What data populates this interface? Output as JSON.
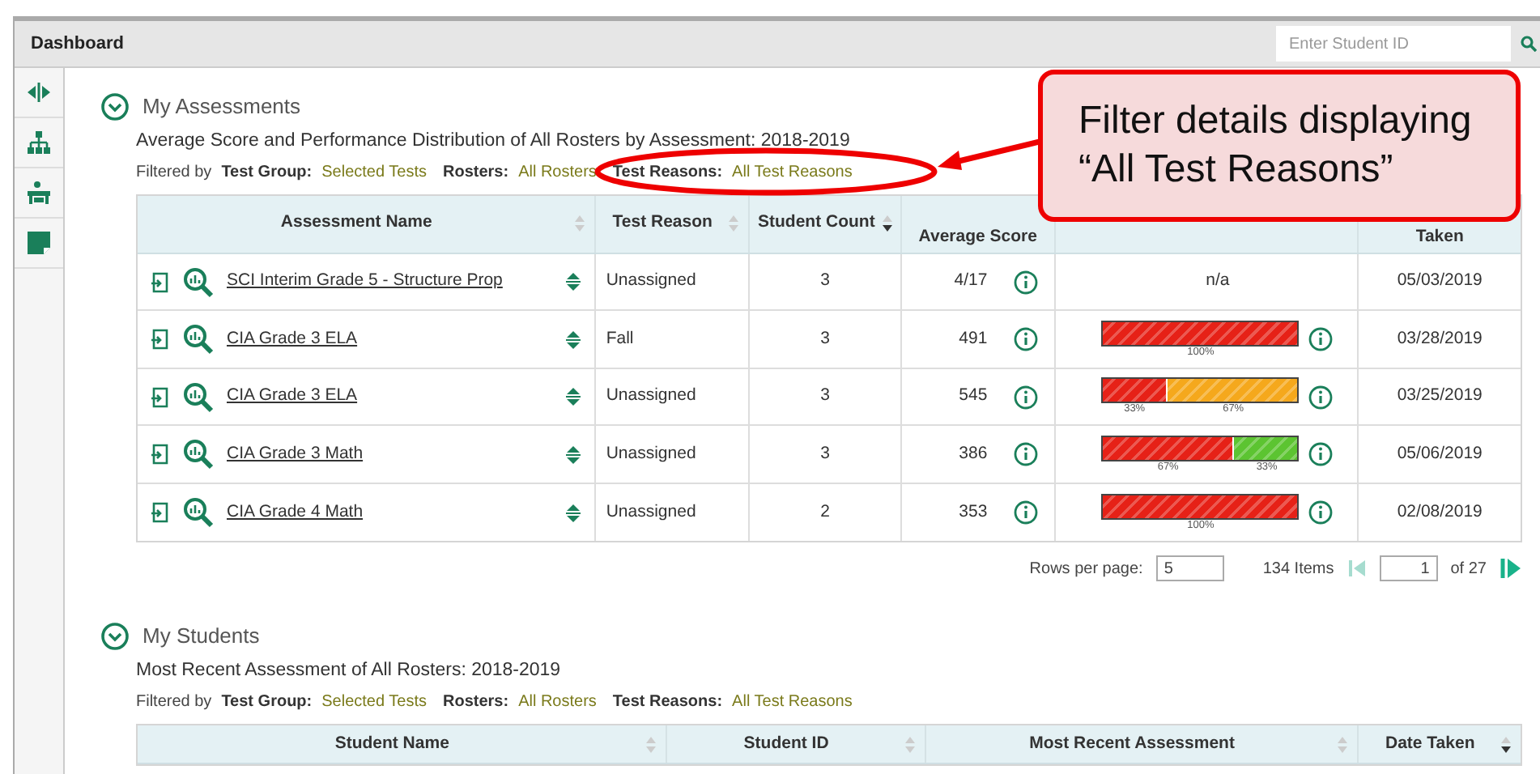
{
  "header": {
    "title": "Dashboard",
    "search": {
      "placeholder": "Enter Student ID"
    }
  },
  "assessments": {
    "title": "My Assessments",
    "expanded": true,
    "subtitle": "Average Score and Performance Distribution of All Rosters by Assessment: 2018-2019",
    "filters": {
      "lead": "Filtered by",
      "items": [
        {
          "label": "Test Group:",
          "value": "Selected Tests"
        },
        {
          "label": "Rosters:",
          "value": "All Rosters"
        },
        {
          "label": "Test Reasons:",
          "value": "All Test Reasons"
        }
      ]
    },
    "columns": [
      {
        "label": "Assessment Name",
        "sortable": true,
        "sorted": false
      },
      {
        "label": "Test Reason",
        "sortable": true,
        "sorted": false
      },
      {
        "label": "Student Count",
        "sortable": true,
        "sorted": true
      },
      {
        "label": "Average Score"
      },
      {
        "label": "Taken"
      }
    ],
    "rows": [
      {
        "name": "SCI Interim Grade 5 - Structure Prop",
        "reason": "Unassigned",
        "count": "3",
        "score": "4/17",
        "na": "n/a",
        "distribution": [],
        "date": "05/03/2019"
      },
      {
        "name": "CIA Grade 3 ELA",
        "reason": "Fall",
        "count": "3",
        "score": "491",
        "distribution": [
          {
            "level": 1,
            "color": "#e62117",
            "label": "100%"
          }
        ],
        "date": "03/28/2019"
      },
      {
        "name": "CIA Grade 3 ELA",
        "reason": "Unassigned",
        "count": "3",
        "score": "545",
        "distribution": [
          {
            "level": 0.33,
            "color": "#e62117",
            "label": "33%"
          },
          {
            "level": 0.67,
            "color": "#f5a81c",
            "label": "67%"
          }
        ],
        "date": "03/25/2019"
      },
      {
        "name": "CIA Grade 3 Math",
        "reason": "Unassigned",
        "count": "3",
        "score": "386",
        "distribution": [
          {
            "level": 0.67,
            "color": "#e62117",
            "label": "67%"
          },
          {
            "level": 0.33,
            "color": "#5cc431",
            "label": "33%"
          }
        ],
        "date": "05/06/2019"
      },
      {
        "name": "CIA Grade 4 Math",
        "reason": "Unassigned",
        "count": "2",
        "score": "353",
        "distribution": [
          {
            "level": 1,
            "color": "#e62117",
            "label": "100%"
          }
        ],
        "date": "02/08/2019"
      }
    ],
    "pager": {
      "rows_label": "Rows per page:",
      "rows_value": "5",
      "items": "134 Items",
      "page": "1",
      "of": "of 27"
    }
  },
  "students": {
    "title": "My Students",
    "expanded": true,
    "subtitle": "Most Recent Assessment of All Rosters: 2018-2019",
    "filters": {
      "lead": "Filtered by",
      "items": [
        {
          "label": "Test Group:",
          "value": "Selected Tests"
        },
        {
          "label": "Rosters:",
          "value": "All Rosters"
        },
        {
          "label": "Test Reasons:",
          "value": "All Test Reasons"
        }
      ]
    },
    "columns": [
      {
        "label": "Student Name",
        "sortable": true,
        "sorted": false
      },
      {
        "label": "Student ID",
        "sortable": true,
        "sorted": false
      },
      {
        "label": "Most Recent Assessment",
        "sortable": true,
        "sorted": false
      },
      {
        "label": "Date Taken",
        "sortable": true,
        "sorted": true
      }
    ]
  },
  "callout": {
    "text": "Filter details displaying “All Test Reasons”"
  }
}
